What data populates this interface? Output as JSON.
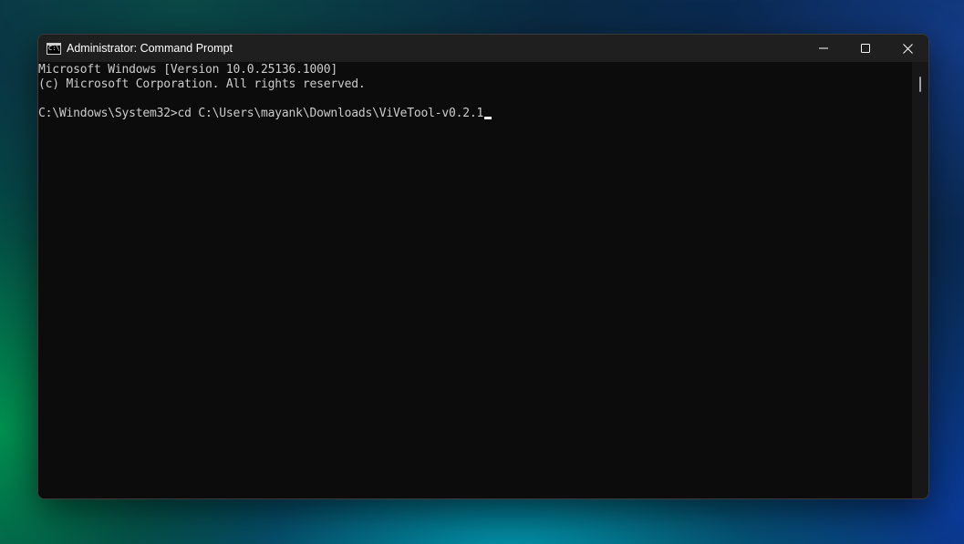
{
  "window": {
    "title": "Administrator: Command Prompt",
    "app_icon": "cmd-icon",
    "app_icon_glyph": "C:\\",
    "caption_buttons": {
      "minimize_icon": "minimize-icon",
      "maximize_icon": "maximize-icon",
      "close_icon": "close-icon"
    }
  },
  "console": {
    "lines": [
      "Microsoft Windows [Version 10.0.25136.1000]",
      "(c) Microsoft Corporation. All rights reserved.",
      "",
      "C:\\Windows\\System32>cd C:\\Users\\mayank\\Downloads\\ViVeTool-v0.2.1"
    ],
    "text_color": "#cccccc",
    "background_color": "#0c0c0c"
  },
  "colors": {
    "titlebar": "#1f1f1f",
    "close_hover": "#c42b1c"
  }
}
